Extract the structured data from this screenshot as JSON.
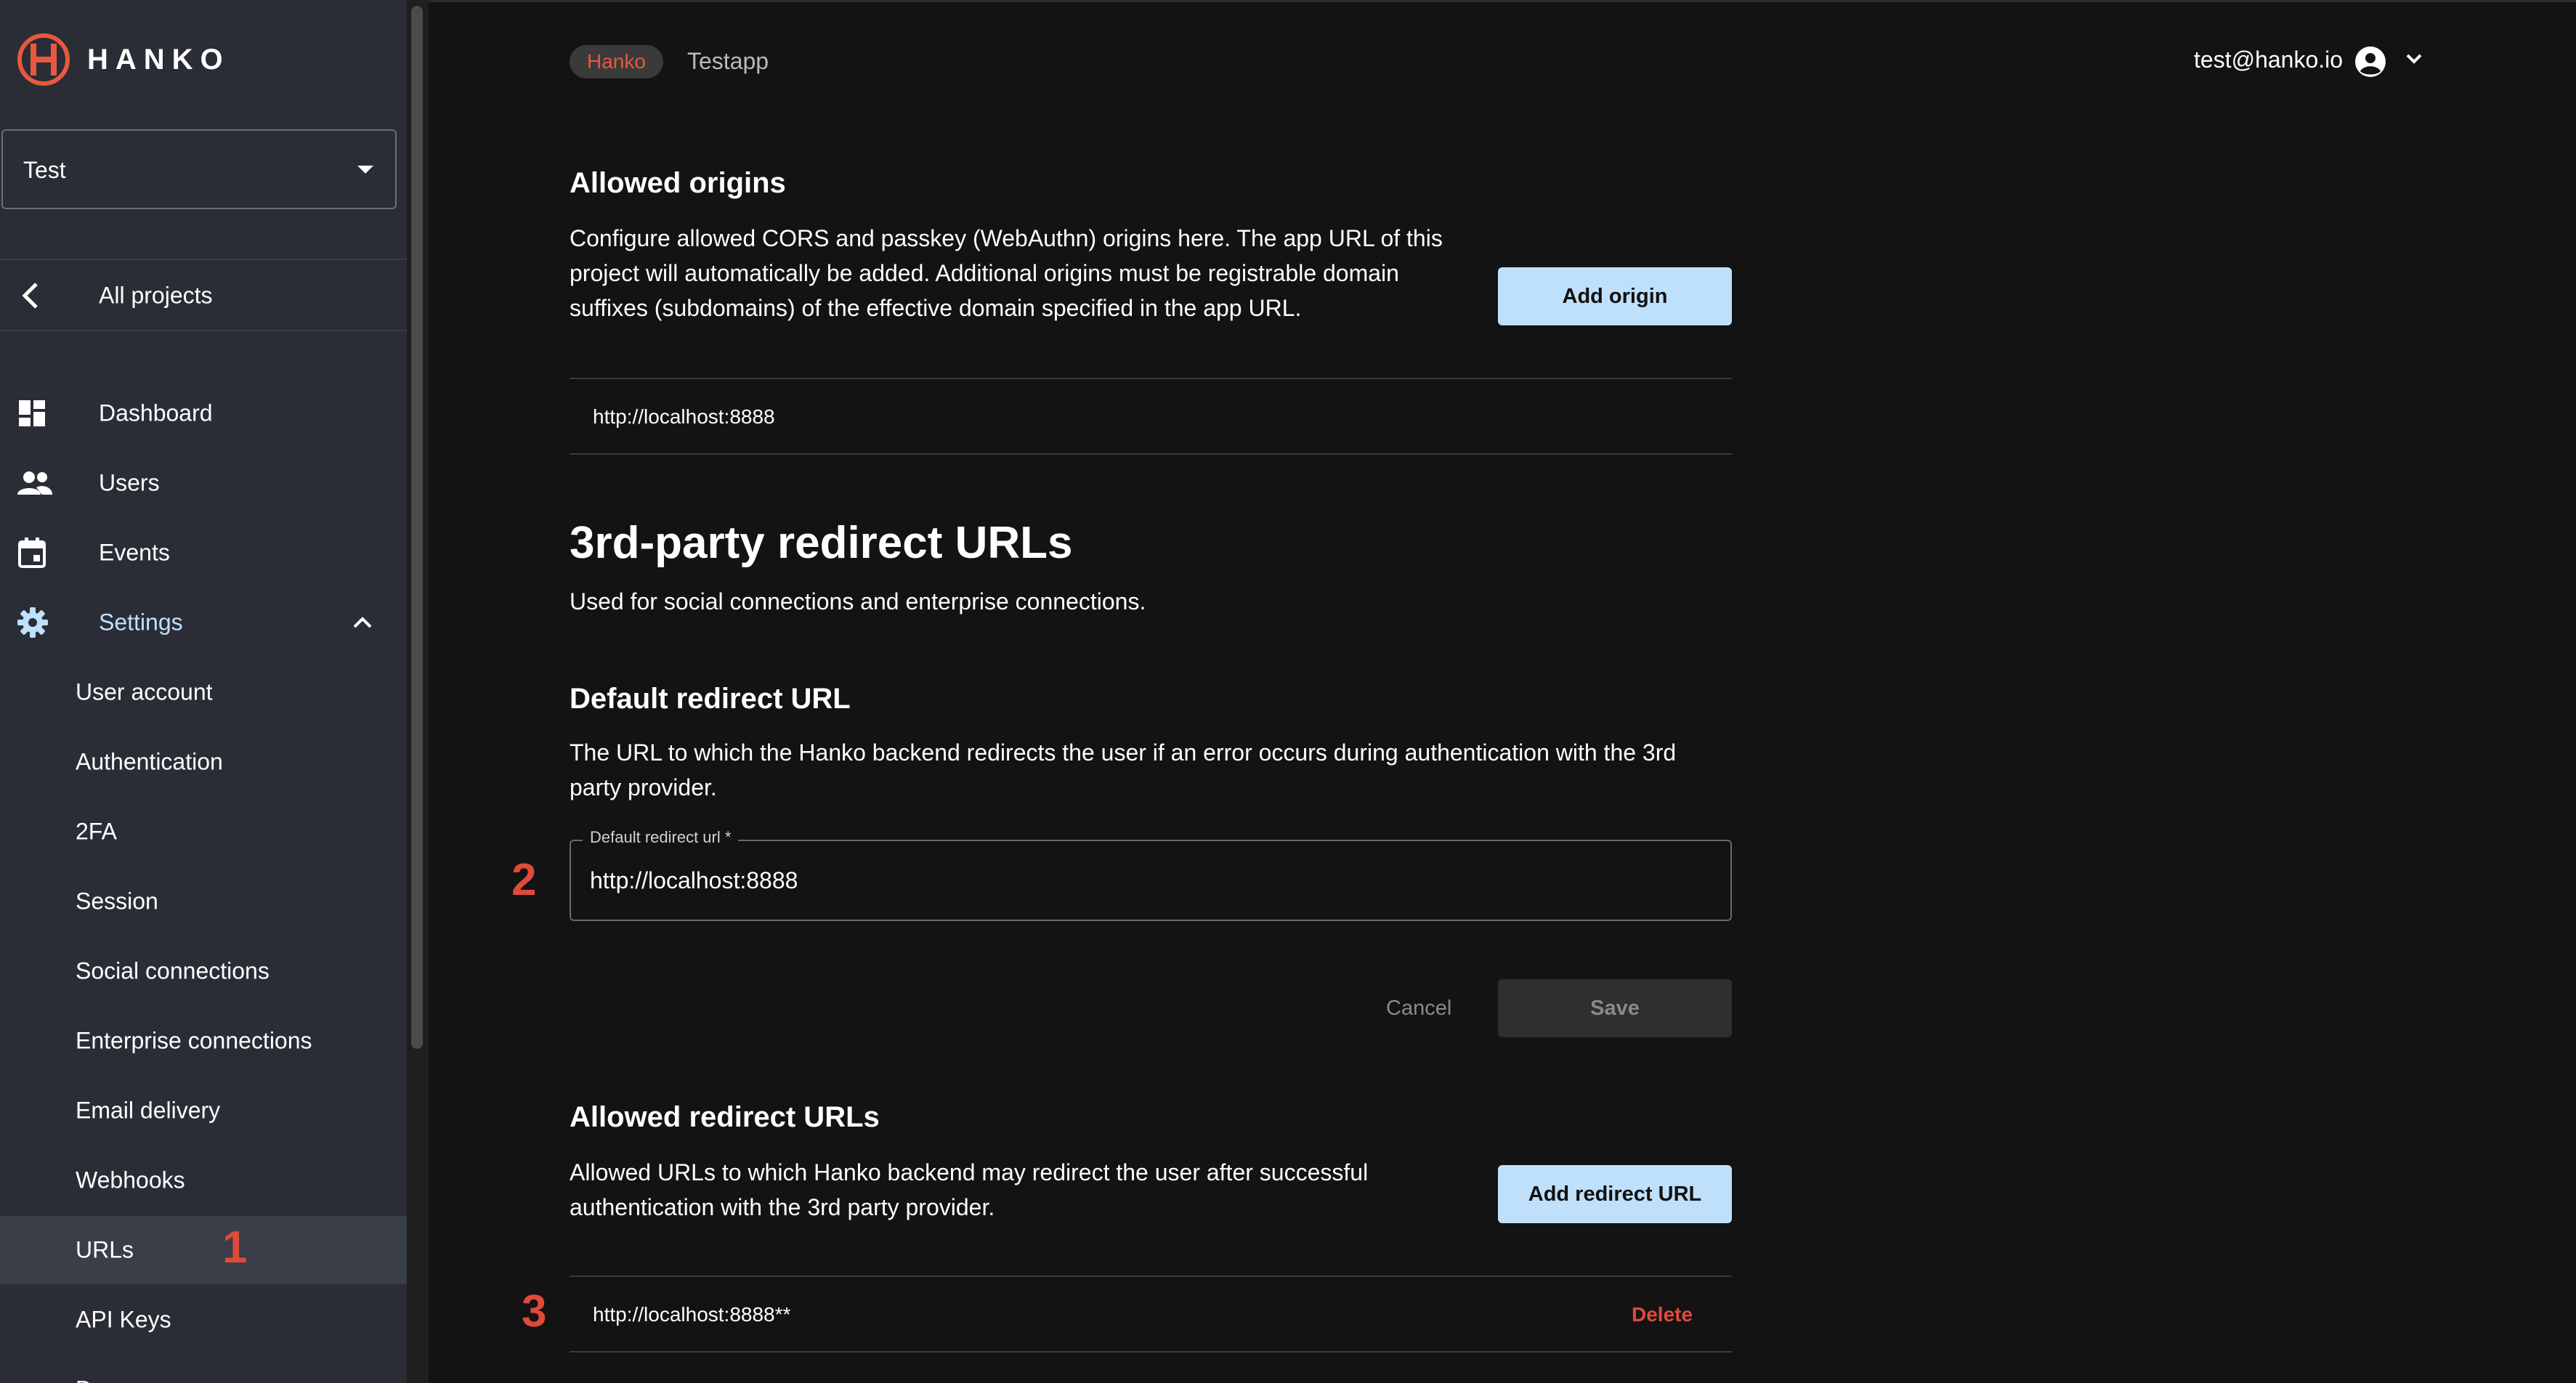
{
  "sidebar": {
    "brand": "HANKO",
    "project_select": "Test",
    "back_label": "All projects",
    "nav": [
      {
        "label": "Dashboard",
        "icon": "dashboard-icon"
      },
      {
        "label": "Users",
        "icon": "users-icon"
      },
      {
        "label": "Events",
        "icon": "calendar-icon"
      },
      {
        "label": "Settings",
        "icon": "gear-icon"
      }
    ],
    "settings_items": [
      {
        "label": "User account"
      },
      {
        "label": "Authentication"
      },
      {
        "label": "2FA"
      },
      {
        "label": "Session"
      },
      {
        "label": "Social connections"
      },
      {
        "label": "Enterprise connections"
      },
      {
        "label": "Email delivery"
      },
      {
        "label": "Webhooks"
      },
      {
        "label": "URLs"
      },
      {
        "label": "API Keys"
      },
      {
        "label": "Danger zone"
      }
    ]
  },
  "header": {
    "org_chip": "Hanko",
    "project_name": "Testapp",
    "user_email": "test@hanko.io"
  },
  "allowed_origins": {
    "title": "Allowed origins",
    "description_lines": [
      "Configure allowed CORS and passkey (WebAuthn) origins here. The app URL of this",
      "project will automatically be added. Additional origins must be registrable domain",
      "suffixes (subdomains) of the effective domain specified in the app URL."
    ],
    "add_button": "Add origin",
    "items": [
      "http://localhost:8888"
    ]
  },
  "redirect_urls": {
    "title": "3rd-party redirect URLs",
    "subtitle": "Used for social connections and enterprise connections."
  },
  "default_redirect": {
    "title": "Default redirect URL",
    "description_lines": [
      "The URL to which the Hanko backend redirects the user if an error occurs during authentication with the 3rd",
      "party provider."
    ],
    "field_label": "Default redirect url *",
    "field_value": "http://localhost:8888",
    "cancel": "Cancel",
    "save": "Save"
  },
  "allowed_redirects": {
    "title": "Allowed redirect URLs",
    "description_lines": [
      "Allowed URLs to which Hanko backend may redirect the user after successful",
      "authentication with the 3rd party provider."
    ],
    "add_button": "Add redirect URL",
    "items": [
      {
        "url": "http://localhost:8888**",
        "delete": "Delete"
      }
    ]
  },
  "annotations": {
    "n1": "1",
    "n2": "2",
    "n3": "3"
  },
  "colors": {
    "accent_blue": "#bfe0fb",
    "danger": "#e04a3a",
    "sidebar_bg": "#2a2d35",
    "content_bg": "#131313"
  }
}
